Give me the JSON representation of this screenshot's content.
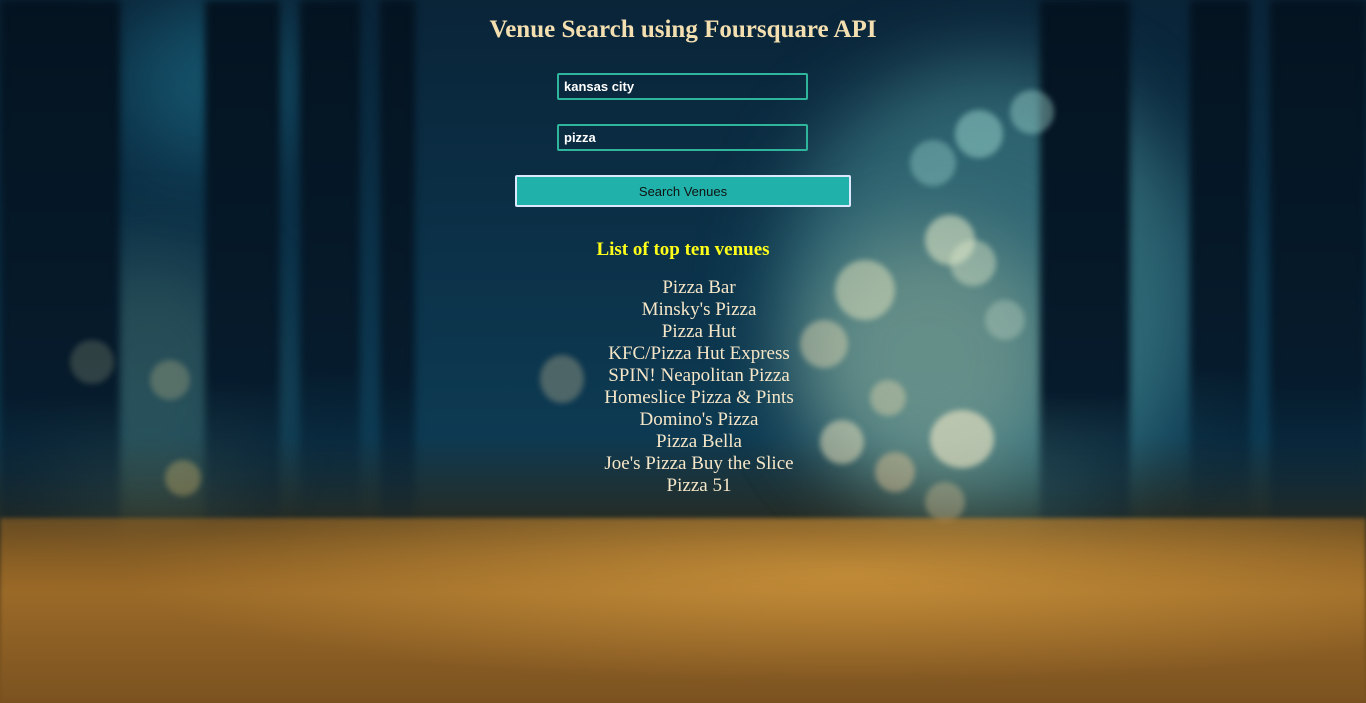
{
  "page": {
    "title": "Venue Search using Foursquare API"
  },
  "search": {
    "location_value": "kansas city",
    "query_value": "pizza",
    "button_label": "Search Venues"
  },
  "results": {
    "heading": "List of top ten venues",
    "venues": [
      "Pizza Bar",
      "Minsky's Pizza",
      "Pizza Hut",
      "KFC/Pizza Hut Express",
      "SPIN! Neapolitan Pizza",
      "Homeslice Pizza & Pints",
      "Domino's Pizza",
      "Pizza Bella",
      "Joe's Pizza Buy the Slice",
      "Pizza 51"
    ]
  },
  "colors": {
    "title": "#f3dfb0",
    "heading": "#ffff1a",
    "button": "#20b2aa",
    "input_border": "#2fb59b",
    "venue_text": "#f5e6c8"
  }
}
